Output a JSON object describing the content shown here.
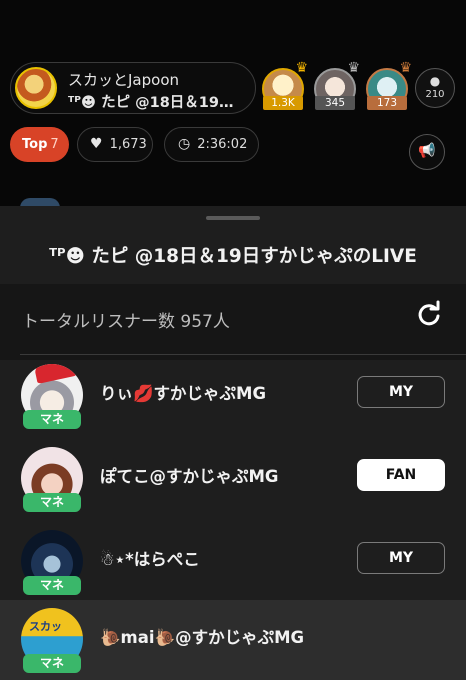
{
  "live": {
    "host_line1": "スカッとJapoon",
    "host_line2": "ᵀᴾ☻ たピ @18日＆19…",
    "ranking": [
      {
        "count": "1.3K",
        "crown_icon": "crown-icon",
        "color": "#d89a00"
      },
      {
        "count": "345",
        "crown_icon": "crown-icon",
        "color": "#555555"
      },
      {
        "count": "173",
        "crown_icon": "crown-icon",
        "color": "#b86d3c"
      }
    ],
    "viewer_count": "210",
    "top_label": "Top",
    "top_rank": "7",
    "likes": "1,673",
    "timer": "2:36:02",
    "icons": {
      "person": "person-icon",
      "heart": "heart-icon",
      "clock": "clock-icon",
      "megaphone": "megaphone-icon"
    },
    "accent_color": "#d84327"
  },
  "sheet": {
    "title": "ᵀᴾ☻ たピ @18日＆19日すかじゃぷのLIVE",
    "total_listeners": "トータルリスナー数 957人",
    "refresh_icon": "refresh-icon",
    "listeners": [
      {
        "name": "りぃ💋すかじゃぷMG",
        "badge": "マネ",
        "button": "MY"
      },
      {
        "name": "ぽてこ@すかじゃぷMG",
        "badge": "マネ",
        "button": "FAN"
      },
      {
        "name": "☃︎⋆*はらぺこ",
        "badge": "マネ",
        "button": "MY"
      },
      {
        "name": "🐌mai🐌@すかじゃぷMG",
        "badge": "マネ",
        "button": ""
      }
    ],
    "badge_color": "#3ab76a"
  }
}
